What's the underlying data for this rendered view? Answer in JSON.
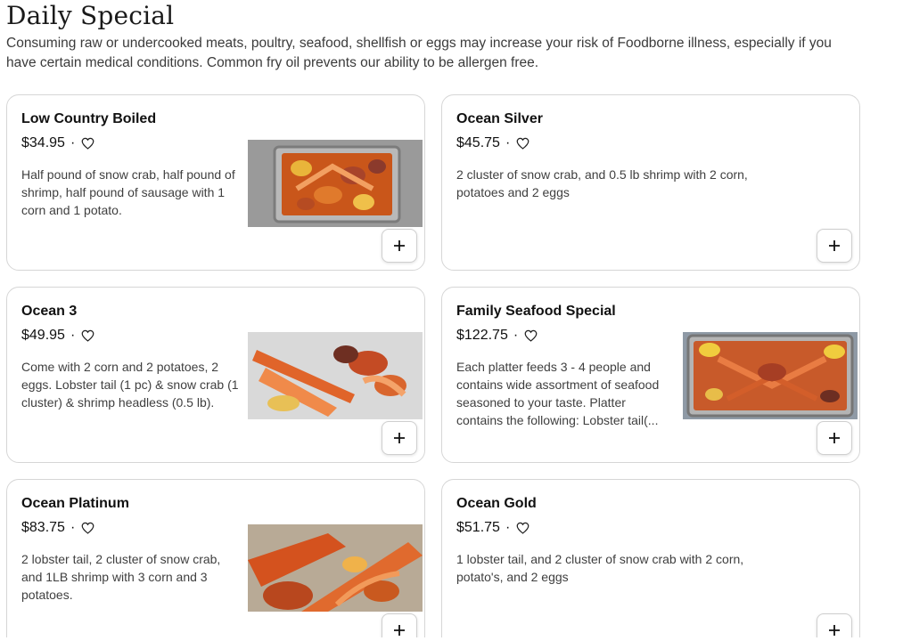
{
  "section": {
    "title": "Daily Special",
    "description": "Consuming raw or undercooked meats, poultry, seafood, shellfish or eggs may increase your risk of Foodborne illness, especially if you have certain medical conditions. Common fry oil prevents our ability to be allergen free."
  },
  "icons": {
    "favorite": "heart-outline-icon",
    "add": "plus-icon"
  },
  "items": [
    {
      "name": "Low Country Boiled",
      "price": "$34.95",
      "description": "Half pound of snow crab, half pound of shrimp, half pound of sausage with 1 corn and 1 potato.",
      "has_image": true
    },
    {
      "name": "Ocean Silver",
      "price": "$45.75",
      "description": "2 cluster of snow crab, and 0.5 lb shrimp with 2 corn, potatoes and 2 eggs",
      "has_image": false
    },
    {
      "name": "Ocean 3",
      "price": "$49.95",
      "description": "Come with 2 corn and 2 potatoes, 2 eggs. Lobster tail (1 pc) & snow crab (1 cluster) & shrimp headless (0.5 lb).",
      "has_image": true
    },
    {
      "name": "Family Seafood Special",
      "price": "$122.75",
      "description": "Each platter feeds 3 - 4 people and contains wide assortment of seafood seasoned to your taste. Platter contains the following: Lobster tail(...",
      "has_image": true
    },
    {
      "name": "Ocean Platinum",
      "price": "$83.75",
      "description": "2 lobster tail, 2 cluster of snow crab, and 1LB shrimp with 3 corn and 3 potatoes.",
      "has_image": true
    },
    {
      "name": "Ocean Gold",
      "price": "$51.75",
      "description": "1 lobster tail, and 2 cluster of snow crab with 2 corn, potato's, and 2 eggs",
      "has_image": false
    }
  ],
  "separator": "·",
  "add_symbol": "+"
}
